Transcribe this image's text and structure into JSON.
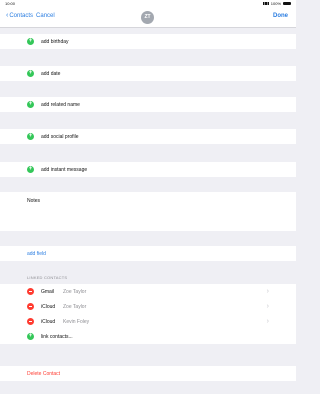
{
  "status_bar": {
    "time": "10:00",
    "battery": "100%"
  },
  "nav": {
    "back_label": "Contacts",
    "cancel_label": "Cancel",
    "avatar_initials": "ZT",
    "done_label": "Done"
  },
  "add_rows": [
    {
      "label": "add birthday"
    },
    {
      "label": "add date"
    },
    {
      "label": "add related name"
    },
    {
      "label": "add social profile"
    },
    {
      "label": "add instant message"
    }
  ],
  "notes": {
    "label": "Notes"
  },
  "add_field": {
    "label": "add field"
  },
  "linked_contacts": {
    "header": "LINKED CONTACTS",
    "items": [
      {
        "service": "Gmail",
        "name": "Zoe Taylor"
      },
      {
        "service": "iCloud",
        "name": "Zoe Taylor"
      },
      {
        "service": "iCloud",
        "name": "Kevin Foley"
      }
    ],
    "link_label": "link contacts..."
  },
  "delete": {
    "label": "Delete Contact"
  },
  "colors": {
    "accent": "#2a7de1",
    "add": "#34c759",
    "remove": "#ff3b30"
  }
}
